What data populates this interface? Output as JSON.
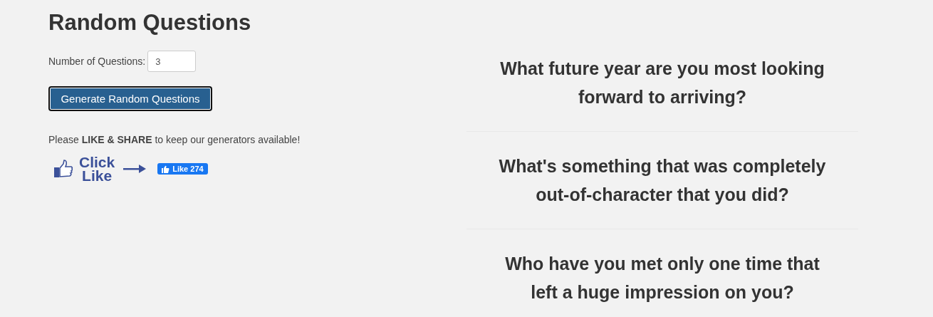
{
  "title": "Random Questions",
  "count_field": {
    "label": "Number of Questions:",
    "value": "3"
  },
  "generate_button": {
    "label": "Generate Random Questions"
  },
  "share_note": "Please **LIKE & SHARE** to keep our generators available!",
  "click_like": {
    "line_1": "Click",
    "line_2": "Like"
  },
  "like_button": {
    "label": "Like 274"
  },
  "questions": [
    {
      "text": "What future year are you most looking forward to arriving?"
    },
    {
      "text": "What's something that was completely out-of-character that you did?"
    },
    {
      "text": "Who have you met only one time that left a huge impression on you?"
    }
  ]
}
